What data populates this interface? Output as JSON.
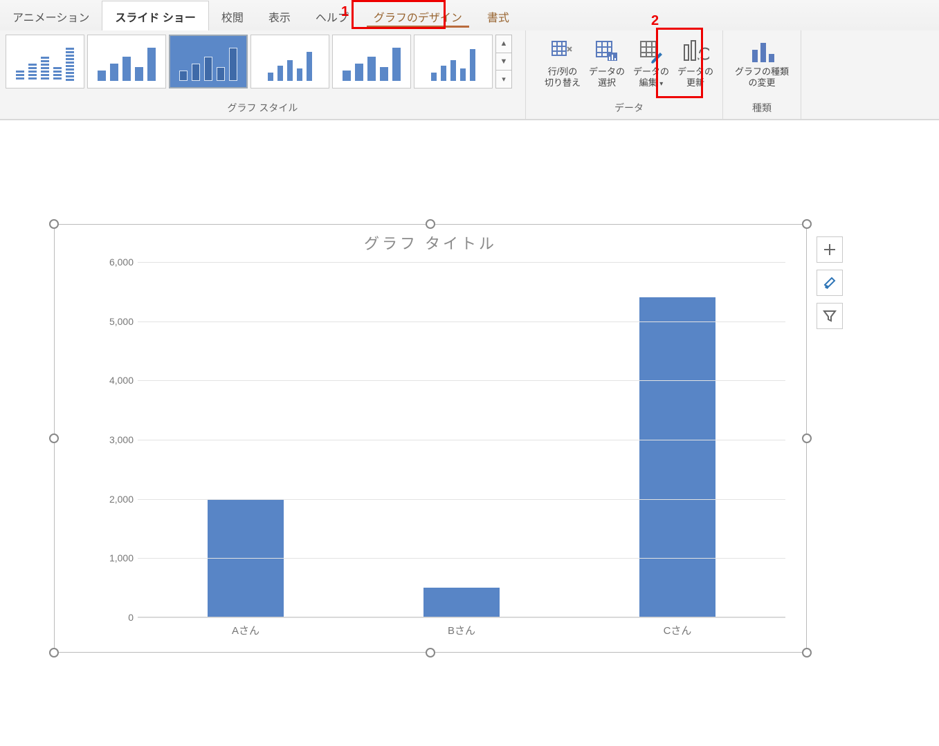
{
  "tabs": {
    "animation": "アニメーション",
    "slideshow": "スライド ショー",
    "review": "校閲",
    "view": "表示",
    "help": "ヘルプ",
    "chart_design": "グラフのデザイン",
    "format": "書式"
  },
  "callouts": {
    "one": "1",
    "two": "2"
  },
  "ribbon_groups": {
    "chart_styles_label": "グラフ スタイル",
    "data_label": "データ",
    "type_label": "種類"
  },
  "data_group": {
    "switch_rowcol_l1": "行/列の",
    "switch_rowcol_l2": "切り替え",
    "select_data_l1": "データの",
    "select_data_l2": "選択",
    "edit_data_l1": "データの",
    "edit_data_l2": "編集",
    "refresh_data_l1": "データの",
    "refresh_data_l2": "更新",
    "change_type_l1": "グラフの種類",
    "change_type_l2": "の変更"
  },
  "chart_data": {
    "type": "bar",
    "title": "グラフ タイトル",
    "categories": [
      "Aさん",
      "Bさん",
      "Cさん"
    ],
    "values": [
      2000,
      500,
      5400
    ],
    "ylabel": "",
    "xlabel": "",
    "ylim": [
      0,
      6000
    ],
    "y_ticks": [
      0,
      1000,
      2000,
      3000,
      4000,
      5000,
      6000
    ],
    "y_tick_labels": [
      "0",
      "1,000",
      "2,000",
      "3,000",
      "4,000",
      "5,000",
      "6,000"
    ],
    "bar_color": "#5885c6"
  },
  "side_tools": {
    "add_element": "chart-elements",
    "styles": "chart-styles",
    "filter": "chart-filter"
  }
}
